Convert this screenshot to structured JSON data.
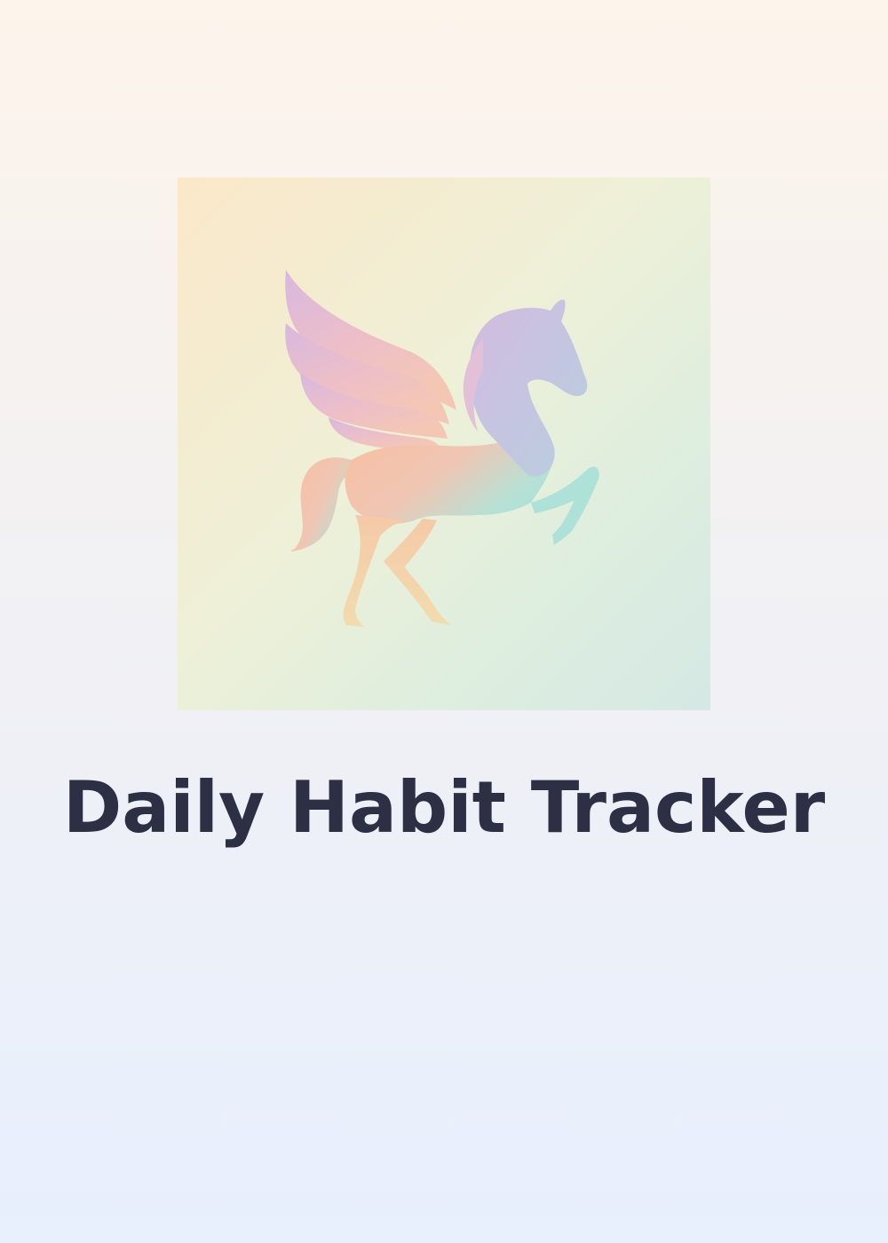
{
  "app": {
    "title": "Daily Habit Tracker",
    "logo_icon": "pegasus-icon"
  },
  "colors": {
    "title_text": "#2d2f45",
    "background_top": "#fdf4eb",
    "background_bottom": "#e8effd",
    "logo_gradient_pink": "#e3b4d6",
    "logo_gradient_peach": "#f5c2a2",
    "logo_gradient_mint": "#a9e2d9",
    "logo_gradient_lilac": "#cdbde0"
  }
}
